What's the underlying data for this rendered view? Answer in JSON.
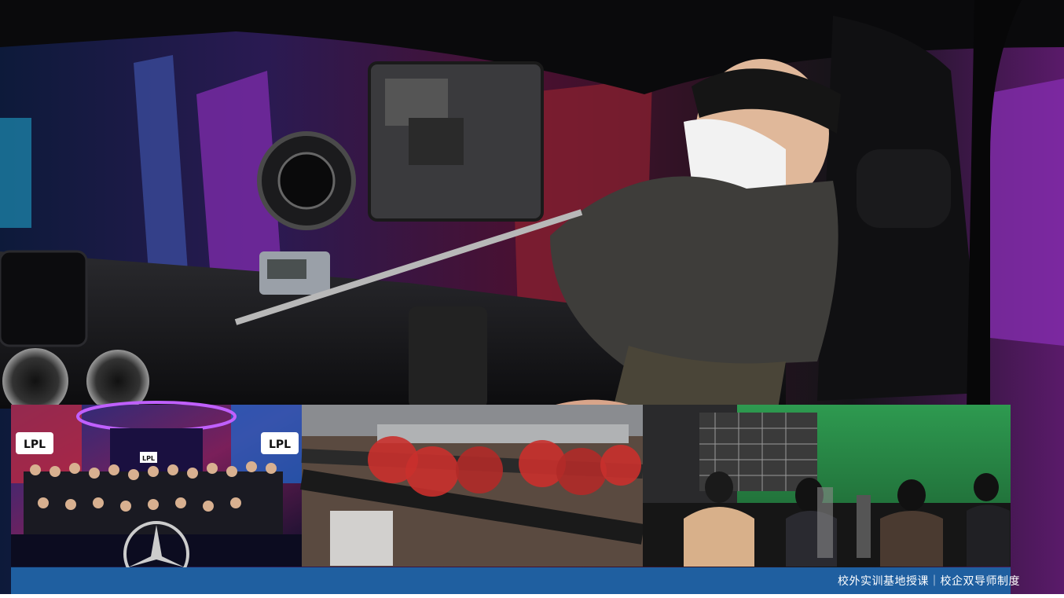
{
  "colors": {
    "background": "#0b0d14",
    "stage_purple": "#8a2fb8",
    "stage_blue": "#1a2a66",
    "caption_band": "#1f5fa0",
    "green_screen": "#2f8a4a",
    "sled_red": "#c9302c"
  },
  "hero_photo": {
    "icon": "camera-icon"
  },
  "inset_photos": [
    {
      "name": "group-photo",
      "logo_left": "LPL",
      "logo_right": "LPL",
      "logo_center": "LPL"
    },
    {
      "name": "camera-slider-photo"
    },
    {
      "name": "green-screen-studio-photo"
    }
  ],
  "caption": {
    "text": "校外实训基地授课｜校企双导师制度"
  }
}
